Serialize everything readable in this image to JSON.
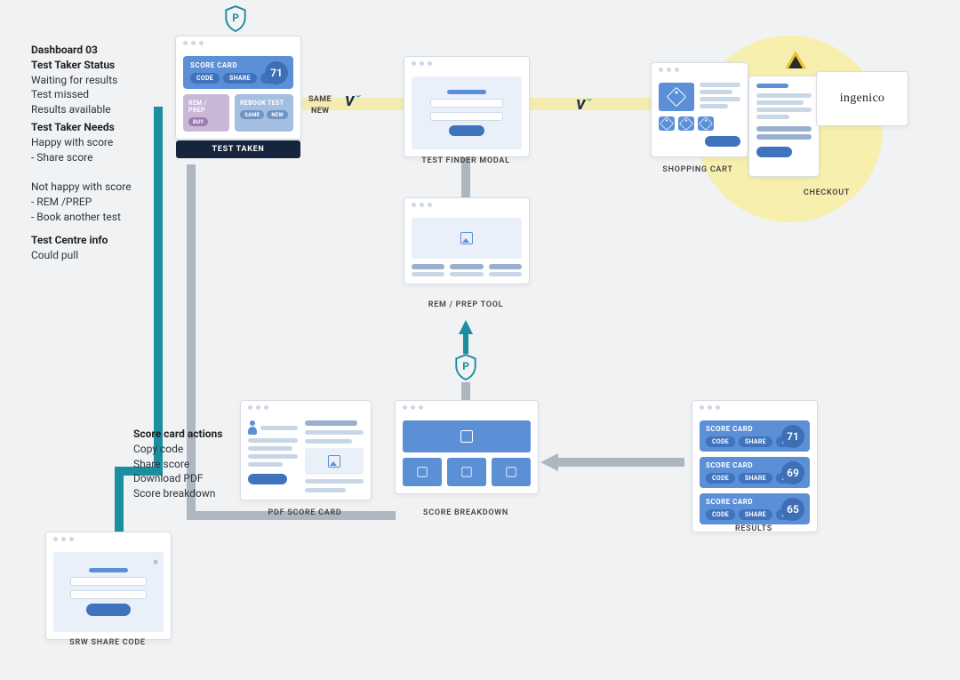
{
  "left": {
    "block1_title": "Dashboard 03",
    "block1_sub": "Test Taker Status",
    "block1_l1": "Waiting for results",
    "block1_l2": "Test missed",
    "block1_l3": "Results available",
    "block2_title": "Test Taker Needs",
    "block2_l1": "Happy with score",
    "block2_l2": "- Share score",
    "block2_l3": "Not happy with score",
    "block2_l4": "- REM /PREP",
    "block2_l5": "- Book another test",
    "block3_title": "Test Centre info",
    "block3_l1": "Could pull",
    "block4_title": "Score card actions",
    "block4_l1": "Copy code",
    "block4_l2": "Share score",
    "block4_l3": "Download PDF",
    "block4_l4": "Score breakdown"
  },
  "labels": {
    "same": "SAME",
    "new": "NEW",
    "test_taken": "TEST TAKEN",
    "test_finder": "TEST FINDER MODAL",
    "shopping_cart": "SHOPPING CART",
    "checkout": "CHECKOUT",
    "rem_prep": "REM / PREP TOOL",
    "pdf": "PDF SCORE CARD",
    "breakdown": "SCORE BREAKDOWN",
    "results": "RESULTS",
    "share": "SRW SHARE CODE"
  },
  "scorecard": {
    "title": "SCORE CARD",
    "chips": [
      "CODE",
      "SHARE",
      "PDF"
    ],
    "score": "71",
    "left_title": "REM / PREP",
    "left_chip": "BUY",
    "right_title": "REBOOK TEST",
    "right_chips": [
      "SAME",
      "NEW"
    ]
  },
  "checkout": {
    "brand": "ingenico"
  },
  "results": {
    "cards": [
      {
        "title": "SCORE CARD",
        "chips": [
          "CODE",
          "SHARE",
          "PDF"
        ],
        "score": "71"
      },
      {
        "title": "SCORE CARD",
        "chips": [
          "CODE",
          "SHARE",
          "PDF"
        ],
        "score": "69"
      },
      {
        "title": "SCORE CARD",
        "chips": [
          "CODE",
          "SHARE",
          "PDF"
        ],
        "score": "65"
      }
    ]
  }
}
